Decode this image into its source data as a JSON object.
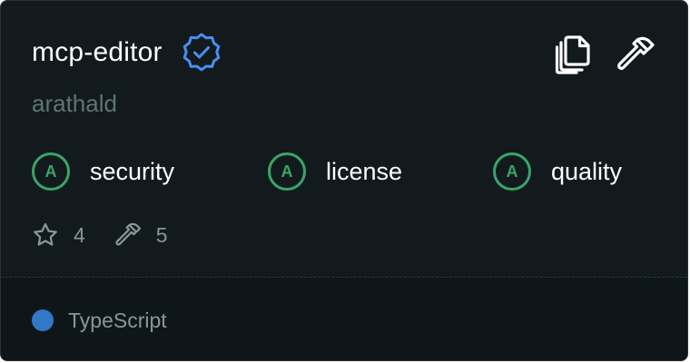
{
  "server": {
    "name": "mcp-editor",
    "author": "arathald",
    "verified": true
  },
  "actions": {
    "copy_icon": "copy-icon",
    "tools_icon": "hammer-icon"
  },
  "scores": [
    {
      "grade": "A",
      "label": "security"
    },
    {
      "grade": "A",
      "label": "license"
    },
    {
      "grade": "A",
      "label": "quality"
    }
  ],
  "stats": {
    "stars": "4",
    "tools": "5"
  },
  "language": {
    "name": "TypeScript",
    "color": "#3178c6"
  },
  "colors": {
    "card_bg": "#121a1d",
    "footer_bg": "#0f1619",
    "verified_blue": "#4a8ff0",
    "grade_green": "#3aa468",
    "muted_text": "#8a949a",
    "author_text": "#5e7570"
  }
}
